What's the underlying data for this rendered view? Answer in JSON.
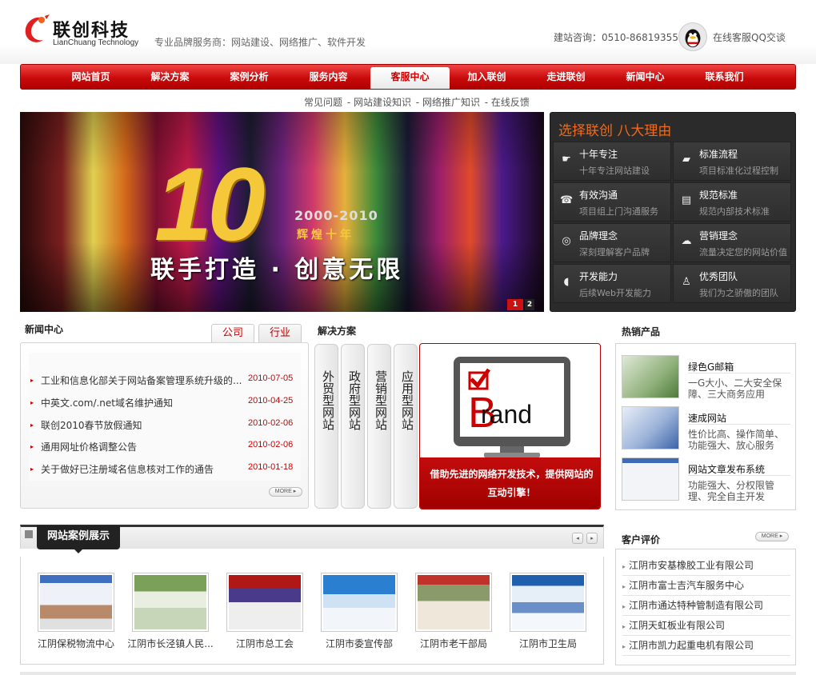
{
  "header": {
    "logo_cn": "联创科技",
    "logo_en": "LianChuang Technology",
    "slogan": "专业品牌服务商：网站建设、网络推广、软件开发",
    "hotline": "建站咨询：0510-86819355",
    "qq_text": "在线客服QQ交谈"
  },
  "nav": {
    "items": [
      {
        "label": "网站首页"
      },
      {
        "label": "解决方案"
      },
      {
        "label": "案例分析"
      },
      {
        "label": "服务内容"
      },
      {
        "label": "客服中心"
      },
      {
        "label": "加入联创"
      },
      {
        "label": "走进联创"
      },
      {
        "label": "新闻中心"
      },
      {
        "label": "联系我们"
      }
    ],
    "active": "客服中心"
  },
  "subnav": [
    "常见问题",
    " - 网站建设知识",
    " - 网络推广知识",
    " - 在线反馈"
  ],
  "banner": {
    "number": "10",
    "years": "2000-2010",
    "glory": "辉煌十年",
    "slogan": "联手打造 · 创意无限",
    "dots": [
      "1",
      "2"
    ]
  },
  "reasons": {
    "title": "选择联创  八大理由",
    "items": [
      {
        "title": "十年专注",
        "sub": "十年专注网站建设",
        "icon": "hand-pointer-icon"
      },
      {
        "title": "标准流程",
        "sub": "项目标准化过程控制",
        "icon": "folder-icon"
      },
      {
        "title": "有效沟通",
        "sub": "项目组上门沟通服务",
        "icon": "phone-icon"
      },
      {
        "title": "规范标准",
        "sub": "规范内部技术标准",
        "icon": "document-icon"
      },
      {
        "title": "品牌理念",
        "sub": "深刻理解客户品牌",
        "icon": "globe-icon"
      },
      {
        "title": "营销理念",
        "sub": "流量决定您的网站价值",
        "icon": "chat-icon"
      },
      {
        "title": "开发能力",
        "sub": "后续Web开发能力",
        "icon": "mouse-icon"
      },
      {
        "title": "优秀团队",
        "sub": "我们为之骄傲的团队",
        "icon": "person-icon"
      }
    ]
  },
  "news": {
    "title": "新闻中心",
    "tabs": [
      "公司",
      "行业"
    ],
    "items": [
      {
        "title": "工业和信息化部关于网站备案管理系统升级的...",
        "date": "2010-07-05"
      },
      {
        "title": "中英文.com/.net域名维护通知",
        "date": "2010-04-25"
      },
      {
        "title": "联创2010春节放假通知",
        "date": "2010-02-06"
      },
      {
        "title": "通用网址价格调整公告",
        "date": "2010-02-06"
      },
      {
        "title": "关于做好已注册域名信息核对工作的通告",
        "date": "2010-01-18"
      }
    ],
    "more": "MORE ▸"
  },
  "solutions": {
    "title": "解决方案",
    "tabs": [
      "外贸型网站",
      "政府型网站",
      "营销型网站",
      "应用型网站"
    ],
    "brand_word": "rand",
    "brand_text": "借助先进的网络开发技术，提供网站的互动引擎！"
  },
  "products": {
    "title": "热销产品",
    "items": [
      {
        "name": "绿色G邮箱",
        "desc": "一G大小、二大安全保障、三大商务应用"
      },
      {
        "name": "速成网站",
        "desc": "性价比高、操作简单、功能强大、放心服务"
      },
      {
        "name": "网站文章发布系统",
        "desc": "功能强大、分权限管理、完全自主开发"
      }
    ]
  },
  "cases": {
    "title": "网站案例展示",
    "items": [
      {
        "name": "江阴保税物流中心"
      },
      {
        "name": "江阴市长泾镇人民..."
      },
      {
        "name": "江阴市总工会"
      },
      {
        "name": "江阴市委宣传部"
      },
      {
        "name": "江阴市老干部局"
      },
      {
        "name": "江阴市卫生局"
      }
    ],
    "prev": "◂",
    "next": "▸"
  },
  "reviews": {
    "title": "客户评价",
    "more": "MORE ▸",
    "items": [
      "江阴市安基橡胶工业有限公司",
      "江阴市富士吉汽车服务中心",
      "江阴市通达特种管制造有限公司",
      "江阴天虹板业有限公司",
      "江阴市凯力起重电机有限公司"
    ]
  },
  "colors": {
    "brand_red": "#c80b0b",
    "accent_orange": "#f26a1b",
    "dark_panel": "#2b2b2b"
  }
}
